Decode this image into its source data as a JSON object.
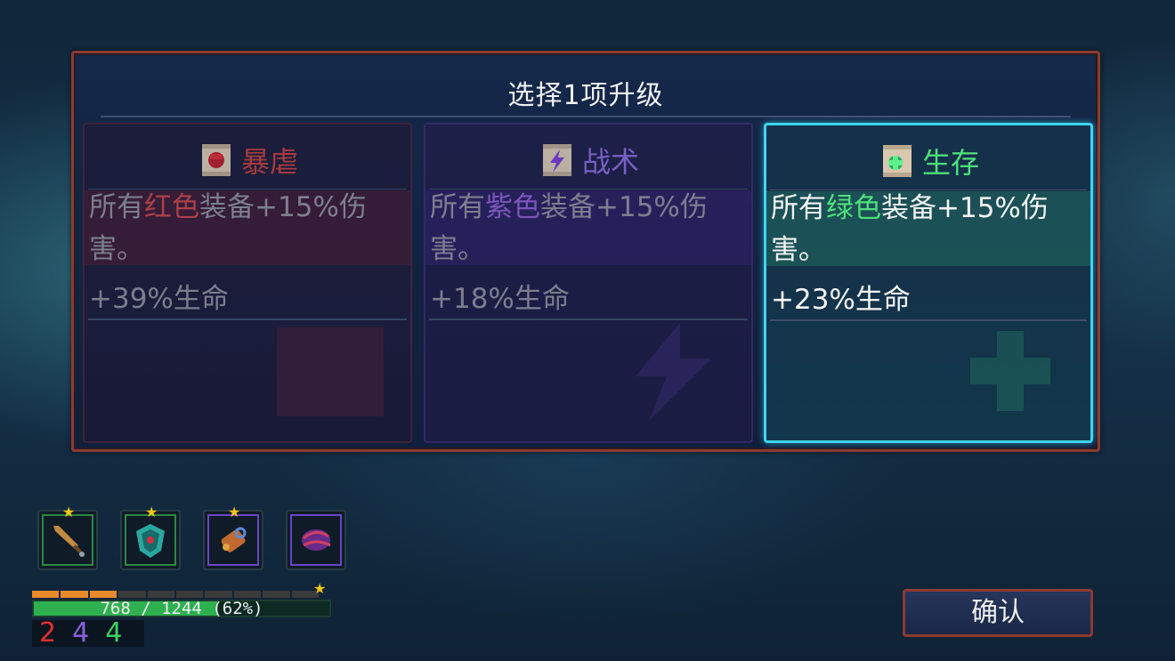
{
  "title": "选择1项升级",
  "cards": [
    {
      "name": "暴虐",
      "icon": "fist-scroll-icon",
      "desc_pre": "所有",
      "desc_color": "红色",
      "desc_post": "装备+15%伤害。",
      "stat": "+39%生命",
      "accent": "#c0403e",
      "selected": false
    },
    {
      "name": "战术",
      "icon": "lightning-scroll-icon",
      "desc_pre": "所有",
      "desc_color": "紫色",
      "desc_post": "装备+15%伤害。",
      "stat": "+18%生命",
      "accent": "#8a6ad8",
      "selected": false
    },
    {
      "name": "生存",
      "icon": "heal-scroll-icon",
      "desc_pre": "所有",
      "desc_color": "绿色",
      "desc_post": "装备+15%伤害。",
      "stat": "+23%生命",
      "accent": "#4ee07a",
      "selected": true
    }
  ],
  "equipment": [
    {
      "icon": "sword-icon",
      "border": "#2a8a40"
    },
    {
      "icon": "shield-icon",
      "border": "#2a8a40"
    },
    {
      "icon": "bomb-icon",
      "border": "#6a44c8"
    },
    {
      "icon": "claw-icon",
      "border": "#6a44c8"
    }
  ],
  "health": {
    "text": "768 / 1244 (62%)",
    "fraction": 0.62,
    "level_segments_total": 10,
    "level_segments_filled": 3
  },
  "counts": [
    {
      "value": "2",
      "color": "#e03030"
    },
    {
      "value": "4",
      "color": "#8a60e0"
    },
    {
      "value": "4",
      "color": "#3ed060"
    }
  ],
  "confirm_label": "确认"
}
